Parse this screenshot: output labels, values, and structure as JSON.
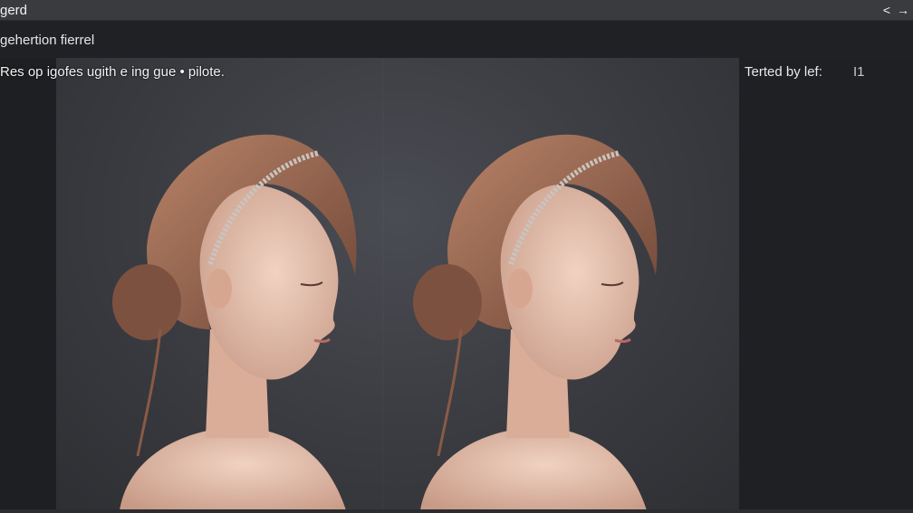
{
  "window": {
    "title": "gerd",
    "nav_back": "<",
    "nav_forward": "→"
  },
  "header": {
    "subtitle": "gehertion fierrel"
  },
  "prompt": {
    "text": "Res op igofes ugith e ing gue • pilote."
  },
  "side_panel": {
    "label": "Terted by lef:",
    "value": "I1"
  },
  "images": [
    {
      "name": "generated-portrait-left"
    },
    {
      "name": "generated-portrait-right"
    }
  ],
  "colors": {
    "background": "#202124",
    "titlebar": "#3a3b3e",
    "canvas": "#3a3b40",
    "hair": "#9a6a52",
    "skin": "#e8c3b0"
  }
}
